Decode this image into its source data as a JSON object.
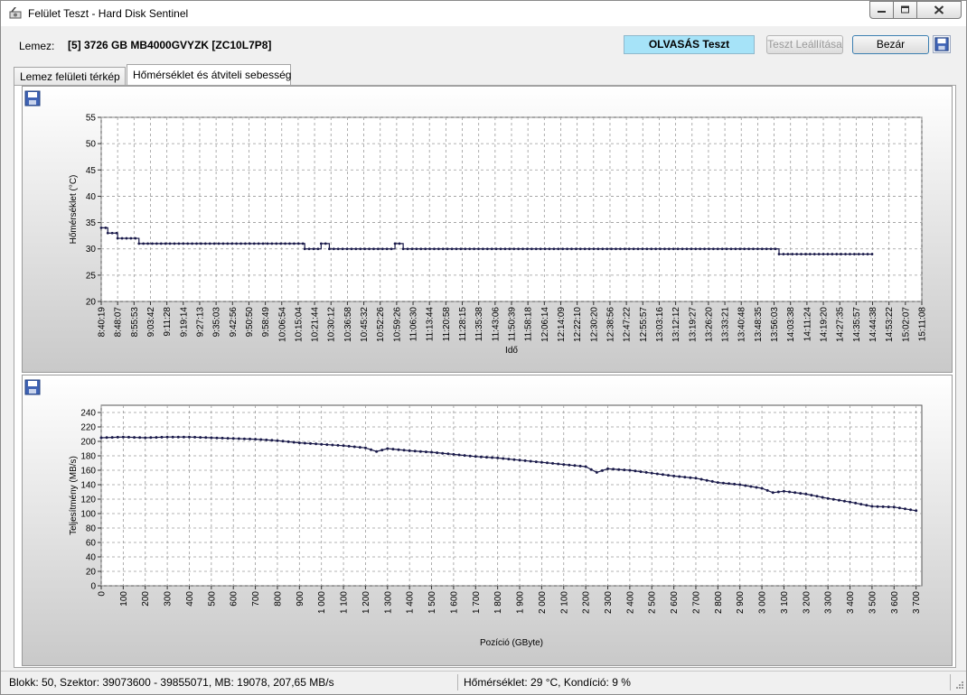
{
  "window": {
    "title": "Felület Teszt - Hard Disk Sentinel"
  },
  "header": {
    "disk_label": "Lemez:",
    "disk_name": "[5] 3726 GB  MB4000GVYZK [ZC10L7P8]",
    "status": "OLVASÁS Teszt",
    "stop_button": "Teszt Leállítása",
    "close_button": "Bezár"
  },
  "tabs": [
    {
      "label": "Lemez felületi térkép"
    },
    {
      "label": "Hőmérséklet és átviteli sebesség"
    }
  ],
  "statusbar": {
    "left": "Blokk: 50, Szektor: 39073600 - 39855071, MB: 19078, 207,65 MB/s",
    "right": "Hőmérséklet: 29  °C, Kondíció: 9 %"
  },
  "colors": {
    "status_bg": "#a6e3f8",
    "series": "#1a1a4a"
  },
  "icons": [
    "app-icon",
    "save-icon",
    "minimize-icon",
    "maximize-icon",
    "close-icon"
  ],
  "chart_data": [
    {
      "type": "line",
      "xlabel": "Idő",
      "ylabel": "Hőmérséklet (°C)",
      "ylim": [
        20,
        55
      ],
      "yticks": [
        20,
        25,
        30,
        35,
        40,
        45,
        50,
        55
      ],
      "x_ticks": [
        "8:40:19",
        "8:48:07",
        "8:55:53",
        "9:03:42",
        "9:11:28",
        "9:19:14",
        "9:27:13",
        "9:35:03",
        "9:42:56",
        "9:50:50",
        "9:58:49",
        "10:06:54",
        "10:15:04",
        "10:21:44",
        "10:30:12",
        "10:36:58",
        "10:45:32",
        "10:52:26",
        "10:59:26",
        "11:06:30",
        "11:13:44",
        "11:20:58",
        "11:28:15",
        "11:35:38",
        "11:43:06",
        "11:50:39",
        "11:58:18",
        "12:06:14",
        "12:14:09",
        "12:22:10",
        "12:30:20",
        "12:38:56",
        "12:47:22",
        "12:55:57",
        "13:03:16",
        "13:12:12",
        "13:19:27",
        "13:26:20",
        "13:33:21",
        "13:40:48",
        "13:48:35",
        "13:56:03",
        "14:03:38",
        "14:11:24",
        "14:19:20",
        "14:27:35",
        "14:35:57",
        "14:44:38",
        "14:53:22",
        "15:02:07",
        "15:11:08"
      ],
      "grid": true,
      "series": [
        {
          "segments": [
            {
              "from": 0.0,
              "to": 0.4,
              "value": 34
            },
            {
              "from": 0.4,
              "to": 1.0,
              "value": 33
            },
            {
              "from": 1.0,
              "to": 2.3,
              "value": 32
            },
            {
              "from": 2.3,
              "to": 12.4,
              "value": 31
            },
            {
              "from": 12.4,
              "to": 13.4,
              "value": 30
            },
            {
              "from": 13.4,
              "to": 13.9,
              "value": 31
            },
            {
              "from": 13.9,
              "to": 17.9,
              "value": 30
            },
            {
              "from": 17.9,
              "to": 18.4,
              "value": 31
            },
            {
              "from": 18.4,
              "to": 41.3,
              "value": 30
            },
            {
              "from": 41.3,
              "to": 47.0,
              "value": 29
            }
          ]
        }
      ]
    },
    {
      "type": "line",
      "xlabel": "Pozíció (GByte)",
      "ylabel": "Teljesítmény (MB/s)",
      "ylim": [
        0,
        250
      ],
      "yticks": [
        0,
        20,
        40,
        60,
        80,
        100,
        120,
        140,
        160,
        180,
        200,
        220,
        240
      ],
      "xlim": [
        0,
        3726
      ],
      "x_ticks": [
        "0",
        "100",
        "200",
        "300",
        "400",
        "500",
        "600",
        "700",
        "800",
        "900",
        "1 000",
        "1 100",
        "1 200",
        "1 300",
        "1 400",
        "1 500",
        "1 600",
        "1 700",
        "1 800",
        "1 900",
        "2 000",
        "2 100",
        "2 200",
        "2 300",
        "2 400",
        "2 500",
        "2 600",
        "2 700",
        "2 800",
        "2 900",
        "3 000",
        "3 100",
        "3 200",
        "3 300",
        "3 400",
        "3 500",
        "3 600",
        "3 700"
      ],
      "grid": true,
      "series": [
        {
          "x": [
            0,
            100,
            200,
            300,
            400,
            500,
            600,
            700,
            800,
            900,
            1000,
            1100,
            1200,
            1250,
            1300,
            1400,
            1500,
            1600,
            1700,
            1800,
            1900,
            2000,
            2100,
            2200,
            2250,
            2300,
            2400,
            2500,
            2600,
            2700,
            2800,
            2900,
            3000,
            3050,
            3100,
            3200,
            3300,
            3400,
            3500,
            3600,
            3700
          ],
          "y": [
            205,
            206,
            205,
            206,
            206,
            205,
            204,
            203,
            201,
            198,
            196,
            194,
            191,
            186,
            190,
            187,
            185,
            182,
            179,
            177,
            174,
            171,
            168,
            165,
            157,
            162,
            160,
            156,
            152,
            149,
            143,
            140,
            135,
            129,
            131,
            127,
            121,
            116,
            110,
            109,
            104
          ]
        }
      ]
    }
  ]
}
